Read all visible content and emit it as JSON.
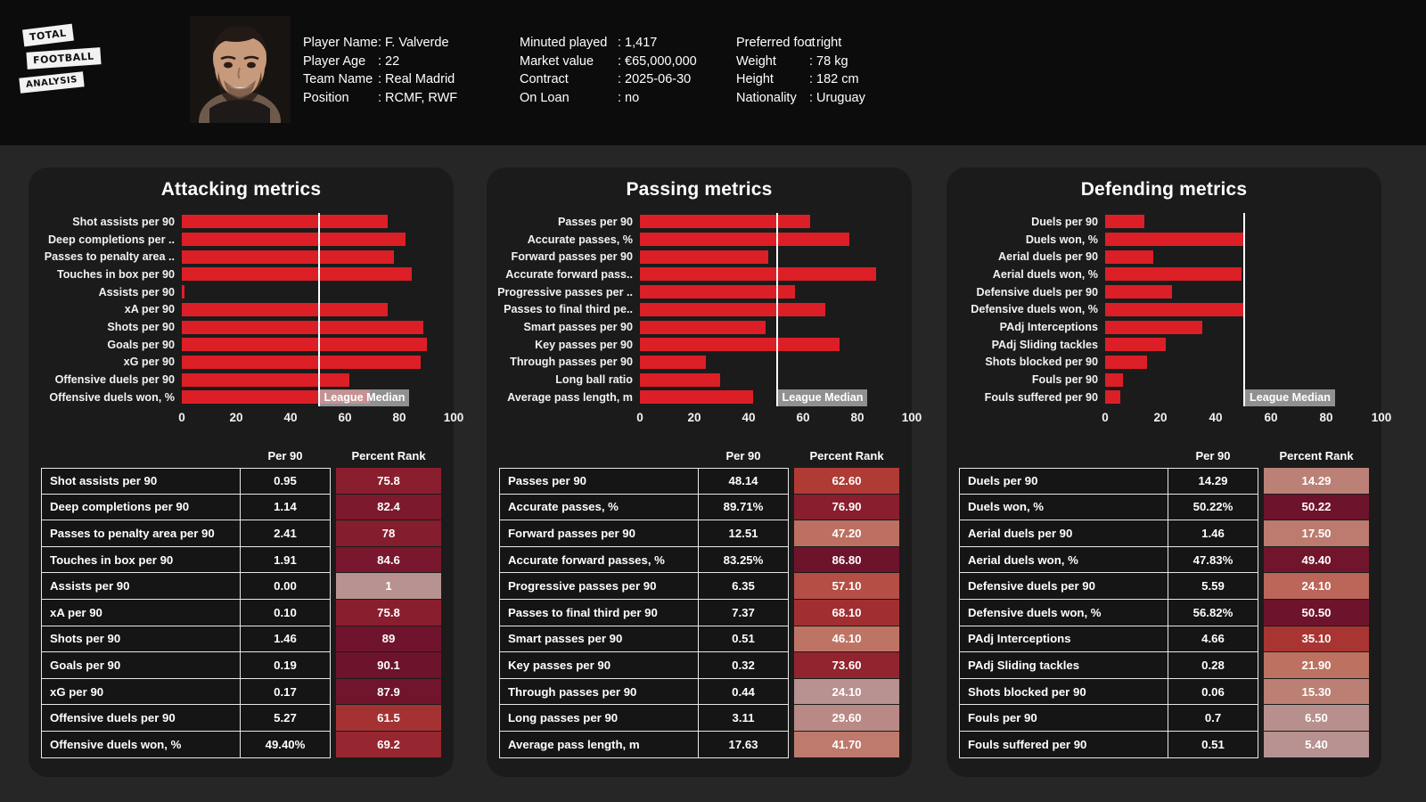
{
  "brand": {
    "line1": "TOTAL",
    "line2": "FOOTBALL",
    "line3": "ANALYSIS"
  },
  "player": {
    "col1": [
      {
        "key": "Player Name",
        "value": ": F. Valverde"
      },
      {
        "key": "Player Age",
        "value": ": 22"
      },
      {
        "key": "Team Name",
        "value": ": Real Madrid"
      },
      {
        "key": "Position",
        "value": ": RCMF, RWF"
      }
    ],
    "col2": [
      {
        "key": "Minuted played",
        "value": ": 1,417"
      },
      {
        "key": "Market value",
        "value": ": €65,000,000"
      },
      {
        "key": "Contract",
        "value": ": 2025-06-30"
      },
      {
        "key": "On Loan",
        "value": ": no"
      }
    ],
    "col3": [
      {
        "key": "Preferred foot",
        "value": ": right"
      },
      {
        "key": "Weight",
        "value": ": 78 kg"
      },
      {
        "key": "Height",
        "value": ": 182 cm"
      },
      {
        "key": "Nationality",
        "value": ": Uruguay"
      }
    ]
  },
  "common": {
    "median_label": "League Median",
    "median_value": 50,
    "axis_ticks": [
      0,
      20,
      40,
      60,
      80,
      100
    ],
    "th_metric": "",
    "th_per90": "Per 90",
    "th_rank": "Percent Rank",
    "bar_color": "#dc1f26",
    "median_color": "#ffffff",
    "panel_bg": "#1b1b1b",
    "page_bg": "#262626",
    "header_bg": "#0c0c0c"
  },
  "chart_data": [
    {
      "type": "bar",
      "title": "Attacking metrics",
      "xlabel": "",
      "ylabel": "",
      "xlim": [
        0,
        100
      ],
      "grid": false,
      "orientation": "horizontal",
      "categories": [
        "Shot assists per 90",
        "Deep completions per ..",
        "Passes to penalty area ..",
        "Touches in box per 90",
        "Assists per 90",
        "xA per 90",
        "Shots per 90",
        "Goals per 90",
        "xG per 90",
        "Offensive duels per 90",
        "Offensive duels won, %"
      ],
      "values": [
        75.8,
        82.4,
        78,
        84.6,
        1,
        75.8,
        89,
        90.1,
        87.9,
        61.5,
        69.2
      ],
      "annotations": [
        "League Median at 50"
      ]
    },
    {
      "type": "bar",
      "title": "Passing metrics",
      "xlabel": "",
      "ylabel": "",
      "xlim": [
        0,
        100
      ],
      "grid": false,
      "orientation": "horizontal",
      "categories": [
        "Passes per 90",
        "Accurate passes, %",
        "Forward passes per 90",
        "Accurate forward pass..",
        "Progressive passes per ..",
        "Passes to final third pe..",
        "Smart passes per 90",
        "Key passes per 90",
        "Through passes per 90",
        "Long ball ratio",
        "Average pass length, m"
      ],
      "values": [
        62.6,
        76.9,
        47.2,
        86.8,
        57.1,
        68.1,
        46.1,
        73.6,
        24.1,
        29.6,
        41.7
      ],
      "annotations": [
        "League Median at 50"
      ]
    },
    {
      "type": "bar",
      "title": "Defending metrics",
      "xlabel": "",
      "ylabel": "",
      "xlim": [
        0,
        100
      ],
      "grid": false,
      "orientation": "horizontal",
      "categories": [
        "Duels per 90",
        "Duels won, %",
        "Aerial duels per 90",
        "Aerial duels won, %",
        "Defensive duels per 90",
        "Defensive duels won, %",
        "PAdj Interceptions",
        "PAdj Sliding tackles",
        "Shots blocked per 90",
        "Fouls per 90",
        "Fouls suffered per 90"
      ],
      "values": [
        14.29,
        50.22,
        17.5,
        49.4,
        24.1,
        50.5,
        35.1,
        21.9,
        15.3,
        6.5,
        5.4
      ],
      "annotations": [
        "League Median at 50"
      ]
    }
  ],
  "tables": [
    {
      "id": "attacking",
      "rows": [
        {
          "metric": "Shot assists per 90",
          "per90": "0.95",
          "rank": "75.8"
        },
        {
          "metric": "Deep completions per 90",
          "per90": "1.14",
          "rank": "82.4"
        },
        {
          "metric": "Passes to penalty area per 90",
          "per90": "2.41",
          "rank": "78"
        },
        {
          "metric": "Touches in box per 90",
          "per90": "1.91",
          "rank": "84.6"
        },
        {
          "metric": "Assists per 90",
          "per90": "0.00",
          "rank": "1"
        },
        {
          "metric": "xA per 90",
          "per90": "0.10",
          "rank": "75.8"
        },
        {
          "metric": "Shots per 90",
          "per90": "1.46",
          "rank": "89"
        },
        {
          "metric": "Goals per 90",
          "per90": "0.19",
          "rank": "90.1"
        },
        {
          "metric": "xG per 90",
          "per90": "0.17",
          "rank": "87.9"
        },
        {
          "metric": "Offensive duels per 90",
          "per90": "5.27",
          "rank": "61.5"
        },
        {
          "metric": "Offensive duels won, %",
          "per90": "49.40%",
          "rank": "69.2"
        }
      ]
    },
    {
      "id": "passing",
      "rows": [
        {
          "metric": "Passes per 90",
          "per90": "48.14",
          "rank": "62.60"
        },
        {
          "metric": "Accurate passes, %",
          "per90": "89.71%",
          "rank": "76.90"
        },
        {
          "metric": "Forward passes per 90",
          "per90": "12.51",
          "rank": "47.20"
        },
        {
          "metric": "Accurate forward passes, %",
          "per90": "83.25%",
          "rank": "86.80"
        },
        {
          "metric": "Progressive passes per 90",
          "per90": "6.35",
          "rank": "57.10"
        },
        {
          "metric": "Passes to final third per 90",
          "per90": "7.37",
          "rank": "68.10"
        },
        {
          "metric": "Smart passes per 90",
          "per90": "0.51",
          "rank": "46.10"
        },
        {
          "metric": "Key passes per 90",
          "per90": "0.32",
          "rank": "73.60"
        },
        {
          "metric": "Through passes per 90",
          "per90": "0.44",
          "rank": "24.10"
        },
        {
          "metric": "Long passes per 90",
          "per90": "3.11",
          "rank": "29.60"
        },
        {
          "metric": "Average pass length, m",
          "per90": "17.63",
          "rank": "41.70"
        }
      ]
    },
    {
      "id": "defending",
      "rows": [
        {
          "metric": "Duels per 90",
          "per90": "14.29",
          "rank": "14.29"
        },
        {
          "metric": "Duels won, %",
          "per90": "50.22%",
          "rank": "50.22"
        },
        {
          "metric": "Aerial duels per 90",
          "per90": "1.46",
          "rank": "17.50"
        },
        {
          "metric": "Aerial duels won, %",
          "per90": "47.83%",
          "rank": "49.40"
        },
        {
          "metric": "Defensive duels per 90",
          "per90": "5.59",
          "rank": "24.10"
        },
        {
          "metric": "Defensive duels won, %",
          "per90": "56.82%",
          "rank": "50.50"
        },
        {
          "metric": "PAdj Interceptions",
          "per90": "4.66",
          "rank": "35.10"
        },
        {
          "metric": "PAdj Sliding tackles",
          "per90": "0.28",
          "rank": "21.90"
        },
        {
          "metric": "Shots blocked per 90",
          "per90": "0.06",
          "rank": "15.30"
        },
        {
          "metric": "Fouls per 90",
          "per90": "0.7",
          "rank": "6.50"
        },
        {
          "metric": "Fouls suffered per 90",
          "per90": "0.51",
          "rank": "5.40"
        }
      ]
    }
  ]
}
